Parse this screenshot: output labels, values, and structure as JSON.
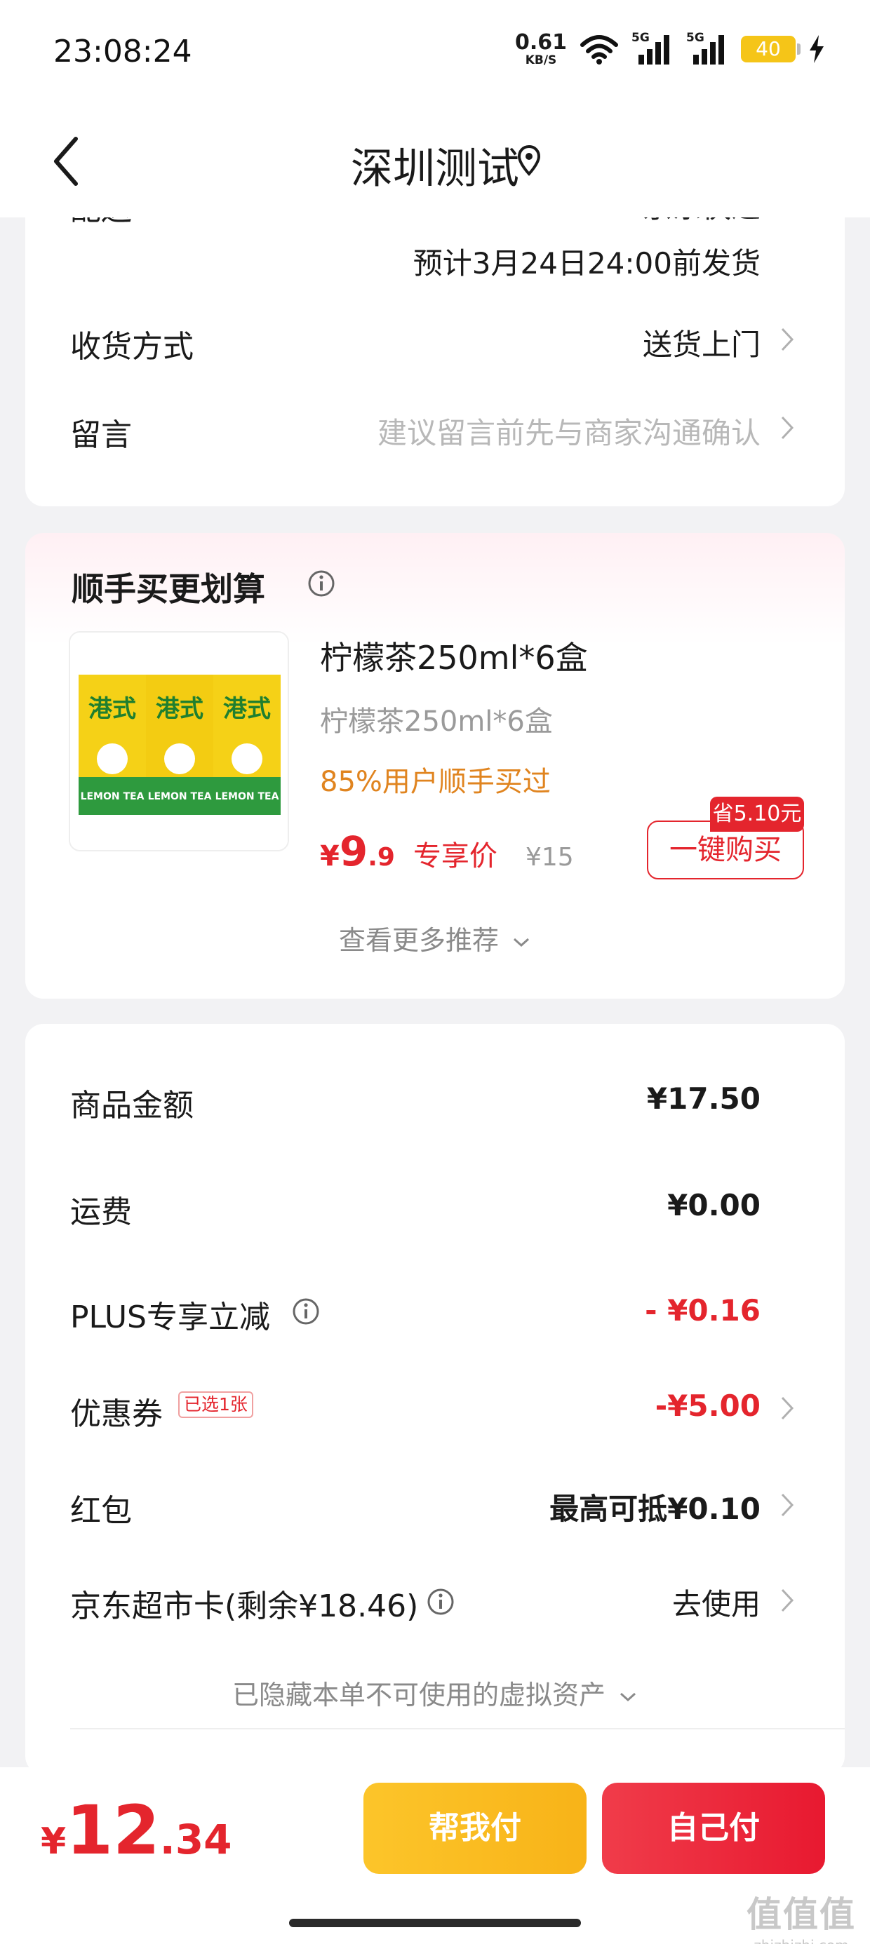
{
  "status_bar": {
    "time": "23:08:24",
    "net_speed": "0.61",
    "net_unit": "KB/S",
    "signal1": "5G",
    "signal2": "5G",
    "battery": "40"
  },
  "nav": {
    "title": "深圳测试",
    "back_icon": "chevron-left-icon",
    "location_icon": "location-pin-icon"
  },
  "delivery": {
    "clipped_label": "配送",
    "clipped_value": "京东快递",
    "ship_note": "预计3月24日24:00前发货",
    "method_label": "收货方式",
    "method_value": "送货上门",
    "message_label": "留言",
    "message_placeholder": "建议留言前先与商家沟通确认"
  },
  "recommend": {
    "title": "顺手买更划算",
    "product_name": "柠檬茶250ml*6盒",
    "product_spec": "柠檬茶250ml*6盒",
    "bought_text": "85%用户顺手买过",
    "price_currency": "¥",
    "price_int": "9",
    "price_dec": ".9",
    "price_tag": "专享价",
    "orig_price": "¥15",
    "save_badge": "省5.10元",
    "buy_button": "一键购买",
    "more_text": "查看更多推荐",
    "pack_label": "LEMON TEA",
    "pack_title": "港式柠檬茶"
  },
  "summary": {
    "goods_label": "商品金额",
    "goods_value": "¥17.50",
    "freight_label": "运费",
    "freight_value": "¥0.00",
    "plus_label": "PLUS专享立减",
    "plus_value": "- ¥0.16",
    "coupon_label": "优惠券",
    "coupon_badge": "已选1张",
    "coupon_value": "-¥5.00",
    "redpacket_label": "红包",
    "redpacket_value": "最高可抵¥0.10",
    "card_label": "京东超市卡(剩余¥18.46)",
    "card_value": "去使用",
    "hidden_note": "已隐藏本单不可使用的虚拟资产"
  },
  "bottom": {
    "total_currency": "¥",
    "total_int": "12",
    "total_dec": ".34",
    "help_pay": "帮我付",
    "self_pay": "自己付"
  },
  "watermark": {
    "line1": "值值值",
    "line2": "zhizhizhi.com"
  },
  "colors": {
    "accent_red": "#e4252d",
    "accent_yellow": "#f8b318",
    "bought_orange": "#e0841f"
  }
}
